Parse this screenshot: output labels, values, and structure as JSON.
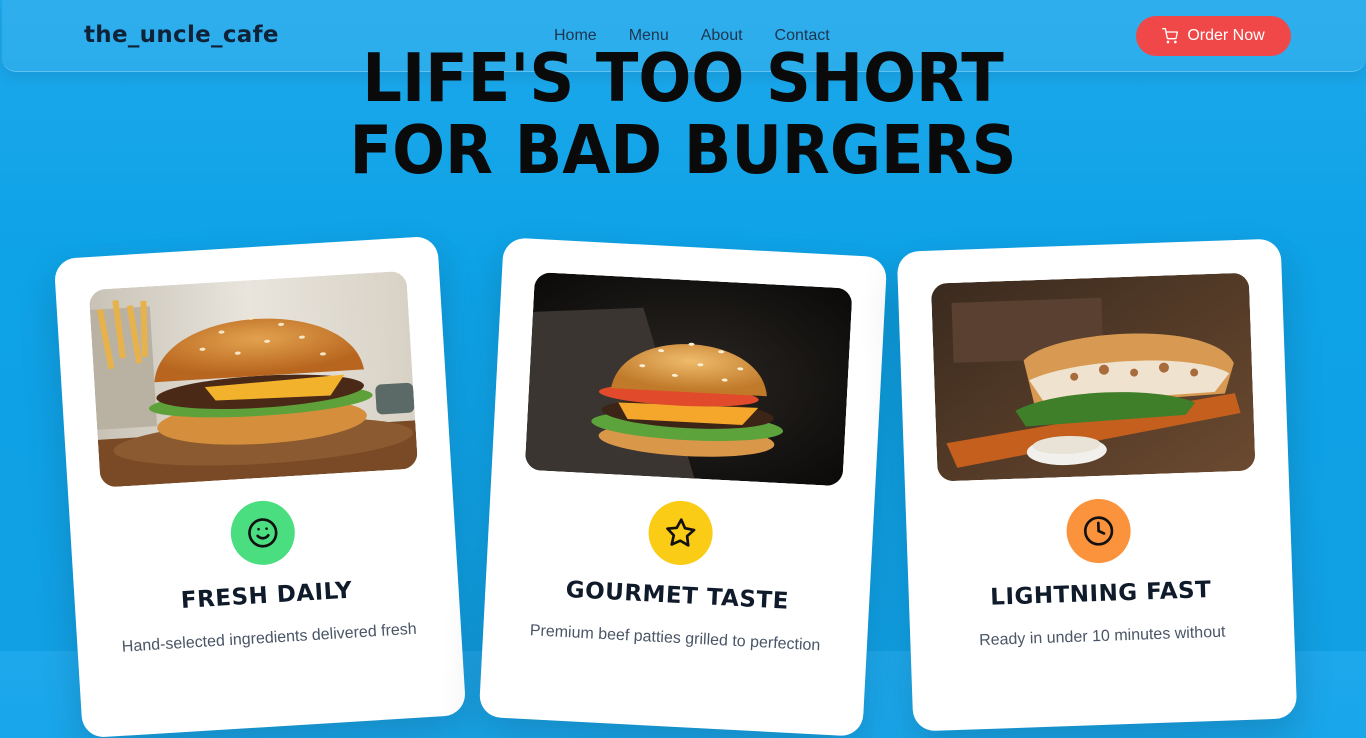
{
  "navbar": {
    "brand": "the_uncle_cafe",
    "links": [
      "Home",
      "Menu",
      "About",
      "Contact"
    ],
    "order_label": "Order Now",
    "order_icon": "cart-icon",
    "order_color": "#f04848"
  },
  "hero": {
    "line1": "LIFE'S TOO SHORT",
    "line2": "FOR BAD BURGERS"
  },
  "cards": [
    {
      "title": "FRESH DAILY",
      "text": "Hand-selected ingredients delivered fresh",
      "icon": "smile-icon",
      "icon_color": "#4ade80",
      "image": "classic-burger-with-fries-photo"
    },
    {
      "title": "GOURMET TASTE",
      "text": "Premium beef patties grilled to perfection",
      "icon": "star-icon",
      "icon_color": "#facc15",
      "image": "cheeseburger-dark-background-photo"
    },
    {
      "title": "LIGHTNING FAST",
      "text": "Ready in under 10 minutes without",
      "icon": "clock-icon",
      "icon_color": "#fb923c",
      "image": "chicken-sub-sandwich-photo"
    }
  ]
}
